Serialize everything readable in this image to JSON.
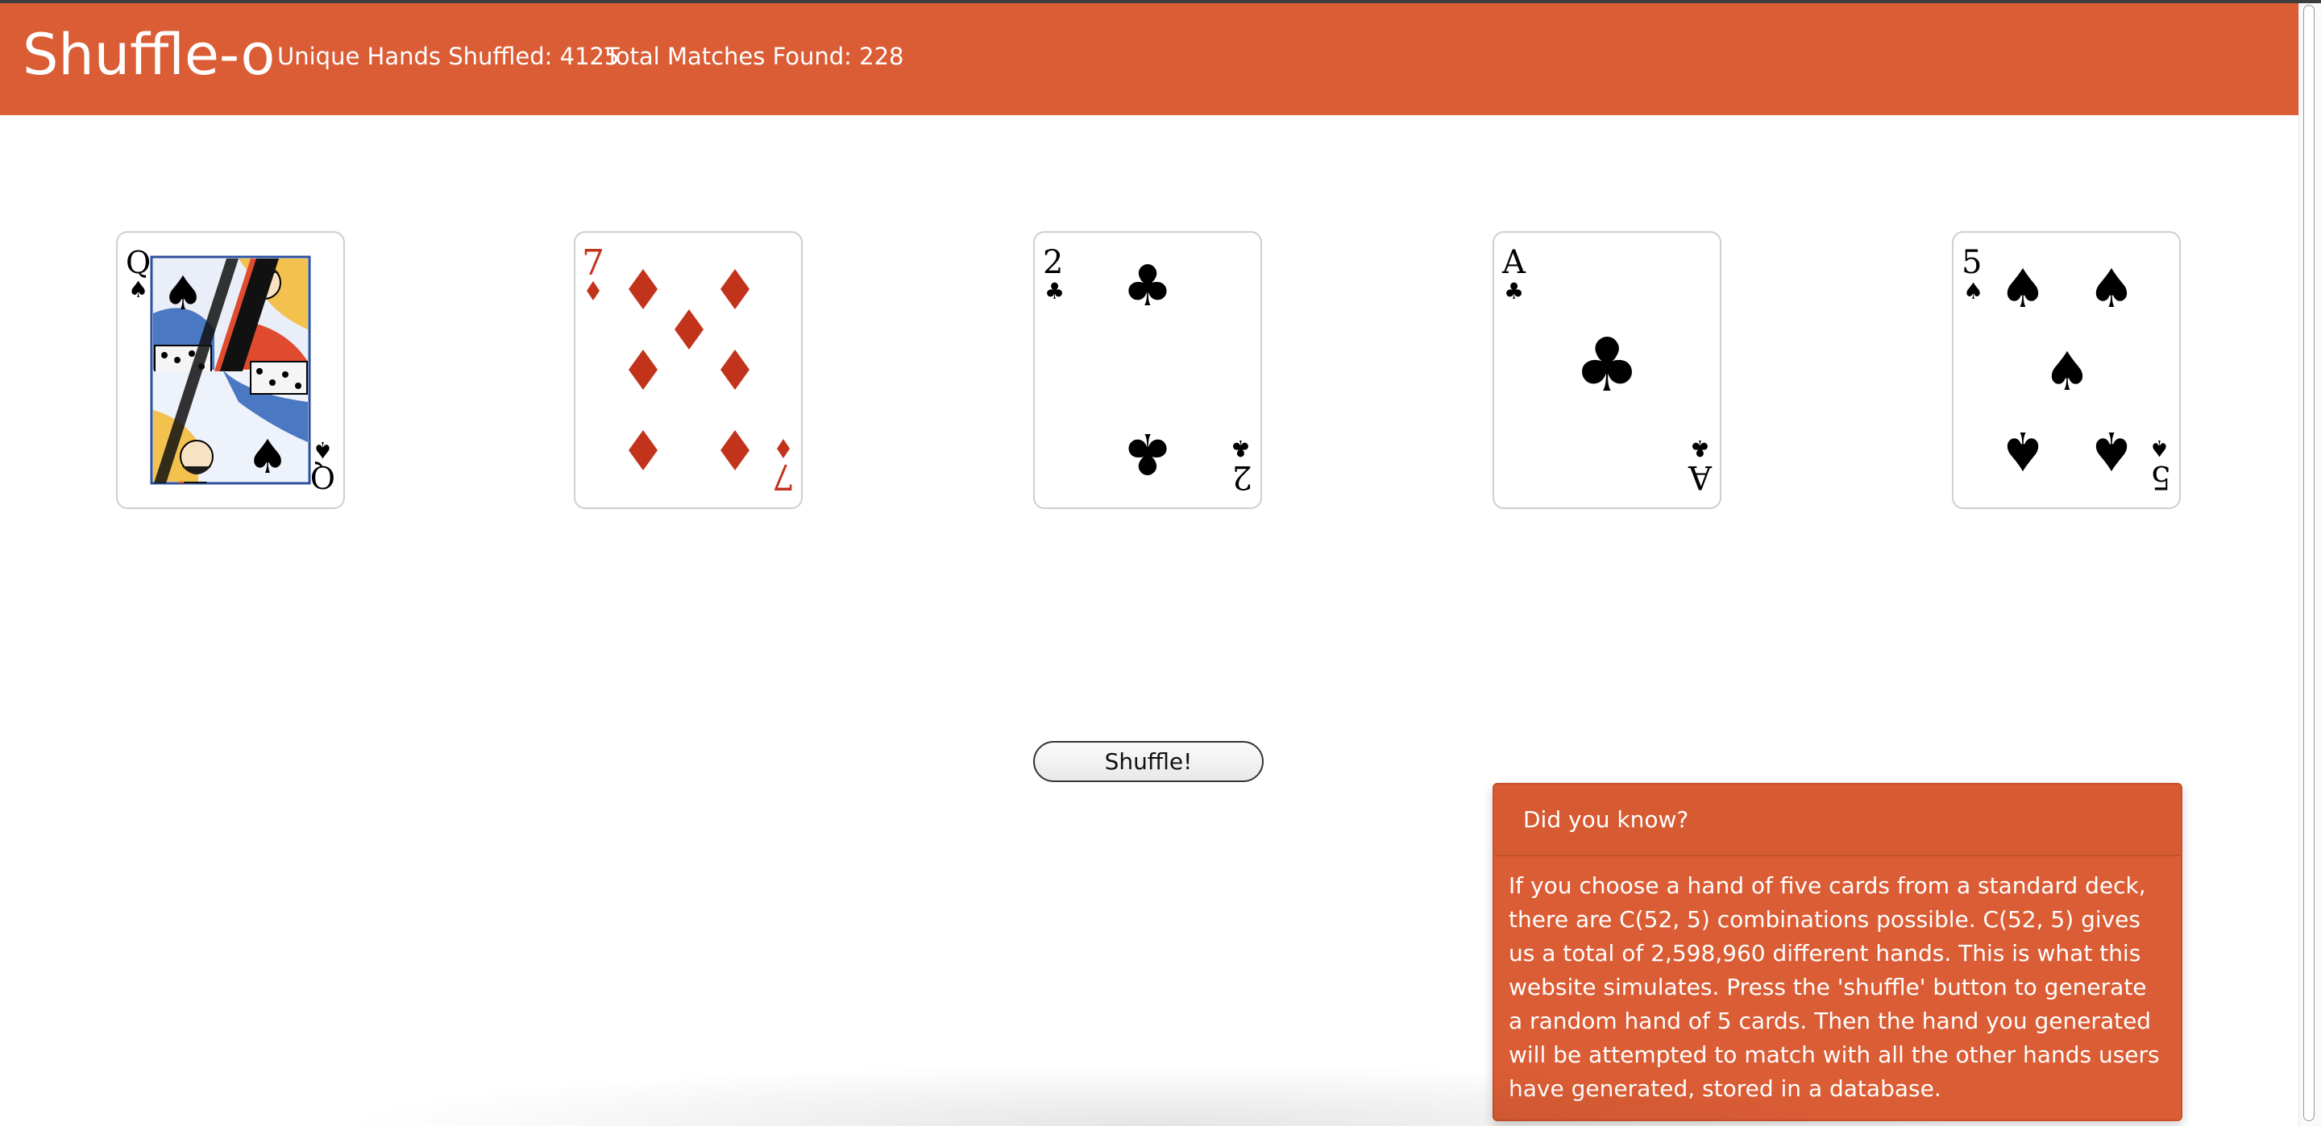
{
  "header": {
    "brand": "Shuffle-o",
    "unique_hands": "Unique Hands Shuffled: 4125",
    "total_matches": "Total Matches Found: 228"
  },
  "cards": [
    {
      "rank": "Q",
      "suit": "spades",
      "suit_symbol": "♠",
      "color": "#000000"
    },
    {
      "rank": "7",
      "suit": "diamonds",
      "suit_symbol": "♦",
      "color": "#c2331b"
    },
    {
      "rank": "2",
      "suit": "clubs",
      "suit_symbol": "♣",
      "color": "#000000"
    },
    {
      "rank": "A",
      "suit": "clubs",
      "suit_symbol": "♣",
      "color": "#000000"
    },
    {
      "rank": "5",
      "suit": "spades",
      "suit_symbol": "♠",
      "color": "#000000"
    }
  ],
  "shuffle_button": "Shuffle!",
  "info": {
    "title": "Did you know?",
    "body": "If you choose a hand of five cards from a standard deck, there are C(52, 5) combinations possible. C(52, 5) gives us a total of 2,598,960 different hands. This is what this website simulates. Press the 'shuffle' button to generate a random hand of 5 cards. Then the hand you generated will be attempted to match with all the other hands users have generated, stored in a database."
  },
  "colors": {
    "accent": "#db5d35",
    "red_suit": "#c2331b"
  }
}
